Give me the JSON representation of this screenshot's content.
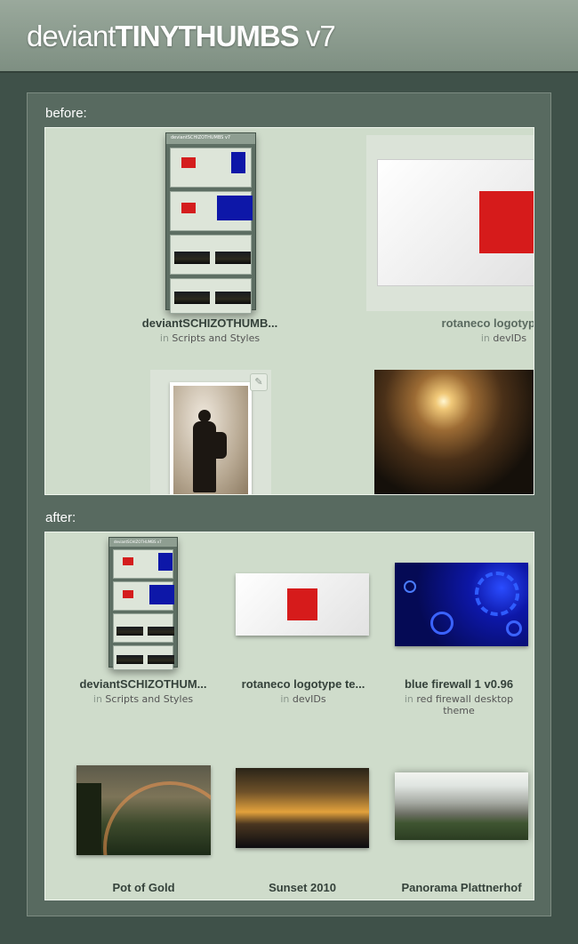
{
  "header": {
    "logo_light": "deviant",
    "logo_bold": "TINYTHUMBS",
    "logo_version": " v7"
  },
  "sections": {
    "before_label": "before:",
    "after_label": "after:"
  },
  "before": [
    {
      "title": "deviantSCHIZOTHUMB...",
      "in": "in",
      "category": "Scripts and Styles"
    },
    {
      "title": "rotaneco logotyp",
      "in": "in",
      "category": "devIDs"
    }
  ],
  "after": [
    {
      "title": "deviantSCHIZOTHUM...",
      "in": "in",
      "category": "Scripts and Styles"
    },
    {
      "title": "rotaneco logotype te...",
      "in": "in",
      "category": "devIDs"
    },
    {
      "title": "blue firewall 1 v0.96",
      "in": "in",
      "category": "red firewall desktop theme"
    },
    {
      "title": "Pot of Gold"
    },
    {
      "title": "Sunset 2010"
    },
    {
      "title": "Panorama Plattnerhof"
    }
  ],
  "mini_header": "deviantSCHIZOTHUMBS v7",
  "icons": {
    "edit": "pencil-icon"
  },
  "colors": {
    "background": "#3f5149",
    "panel": "#586a60",
    "box": "#cfdccb",
    "header": "#8e9e91",
    "logo_red": "#d61b1b",
    "firewall_blue": "#0d17a8"
  }
}
